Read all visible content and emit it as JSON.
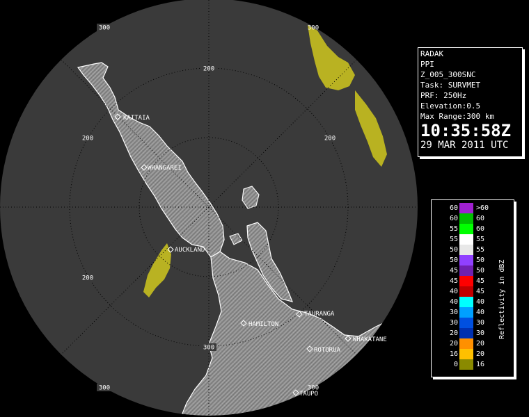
{
  "radar": {
    "range_labels": [
      "200",
      "200",
      "200",
      "200",
      "300",
      "300",
      "300",
      "300",
      "300"
    ],
    "towns": [
      "KAITAIA",
      "WHANGAREI",
      "AUCKLAND",
      "TAURANGA",
      "HAMILTON",
      "ROTORUA",
      "WHAKATANE",
      "TAUPO"
    ]
  },
  "info": {
    "site": "RADAK",
    "product": "PPI",
    "field": "Z_005_300SNC",
    "task": "Task: SURVMET",
    "prf": "PRF: 250Hz",
    "elevation": "Elevation:0.5",
    "max_range": "Max Range:300 km",
    "time": "10:35:58Z",
    "date": "29 MAR 2011 UTC"
  },
  "legend": {
    "title": "Reflectivity in dBZ",
    "rows": [
      {
        "lo": "60",
        "hi": ">60",
        "color": "#a020d0"
      },
      {
        "lo": "60",
        "hi": "60",
        "color": "#00c000"
      },
      {
        "lo": "55",
        "hi": "60",
        "color": "#00ff00"
      },
      {
        "lo": "55",
        "hi": "55",
        "color": "#ffffff"
      },
      {
        "lo": "50",
        "hi": "55",
        "color": "#e8e8e8"
      },
      {
        "lo": "50",
        "hi": "50",
        "color": "#9040ff"
      },
      {
        "lo": "45",
        "hi": "50",
        "color": "#7020b0"
      },
      {
        "lo": "45",
        "hi": "45",
        "color": "#ff0000"
      },
      {
        "lo": "40",
        "hi": "45",
        "color": "#c00000"
      },
      {
        "lo": "40",
        "hi": "40",
        "color": "#00ffff"
      },
      {
        "lo": "30",
        "hi": "40",
        "color": "#00a0ff"
      },
      {
        "lo": "30",
        "hi": "30",
        "color": "#0050e0"
      },
      {
        "lo": "20",
        "hi": "30",
        "color": "#0030b0"
      },
      {
        "lo": "20",
        "hi": "20",
        "color": "#ff9000"
      },
      {
        "lo": "16",
        "hi": "20",
        "color": "#ffc000"
      },
      {
        "lo": "0",
        "hi": "16",
        "color": "#8a8a00"
      }
    ]
  },
  "colors": {
    "land": "#8c8c8c",
    "sea_disc": "#3a3a3a",
    "echo": "#c8c020"
  }
}
